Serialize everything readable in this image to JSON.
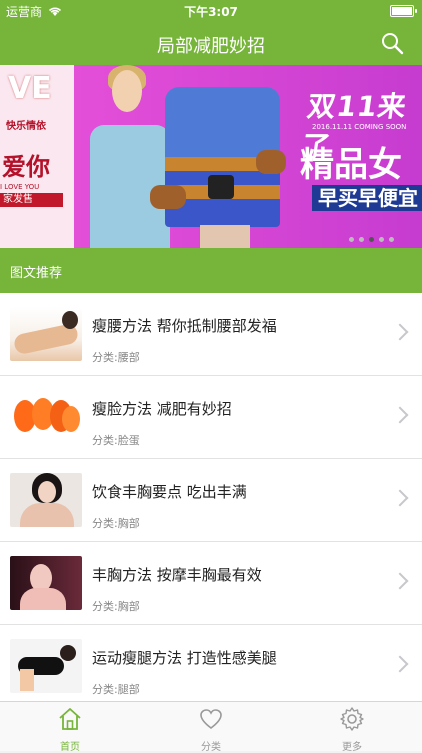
{
  "status_bar": {
    "carrier": "运营商",
    "time": "下午3:07"
  },
  "header": {
    "title": "局部减肥妙招"
  },
  "banner": {
    "left_text_large": "VE",
    "left_text_tag": "快乐情依",
    "left_text_love": "爱你",
    "left_text_sub": "I LOVE YOU",
    "left_text_strip": "家发售",
    "headline": "双11来了",
    "headline_sub": "2016.11.11 COMING SOON",
    "highlight": "精品女",
    "cta": "早买早便宜",
    "dots": 5,
    "active_dot": 2
  },
  "section": {
    "title": "图文推荐"
  },
  "articles": [
    {
      "title": "瘦腰方法 帮你抵制腰部发福",
      "category": "分类:腰部"
    },
    {
      "title": "瘦脸方法 减肥有妙招",
      "category": "分类:脸蛋"
    },
    {
      "title": "饮食丰胸要点 吃出丰满",
      "category": "分类:胸部"
    },
    {
      "title": "丰胸方法 按摩丰胸最有效",
      "category": "分类:胸部"
    },
    {
      "title": "运动瘦腿方法 打造性感美腿",
      "category": "分类:腿部"
    }
  ],
  "tabs": [
    {
      "label": "首页",
      "icon": "home-icon",
      "active": true
    },
    {
      "label": "分类",
      "icon": "heart-icon",
      "active": false
    },
    {
      "label": "更多",
      "icon": "gear-icon",
      "active": false
    }
  ],
  "colors": {
    "accent": "#76b53a",
    "banner": "#d63ed3",
    "cta_blue": "#1e3a94"
  }
}
